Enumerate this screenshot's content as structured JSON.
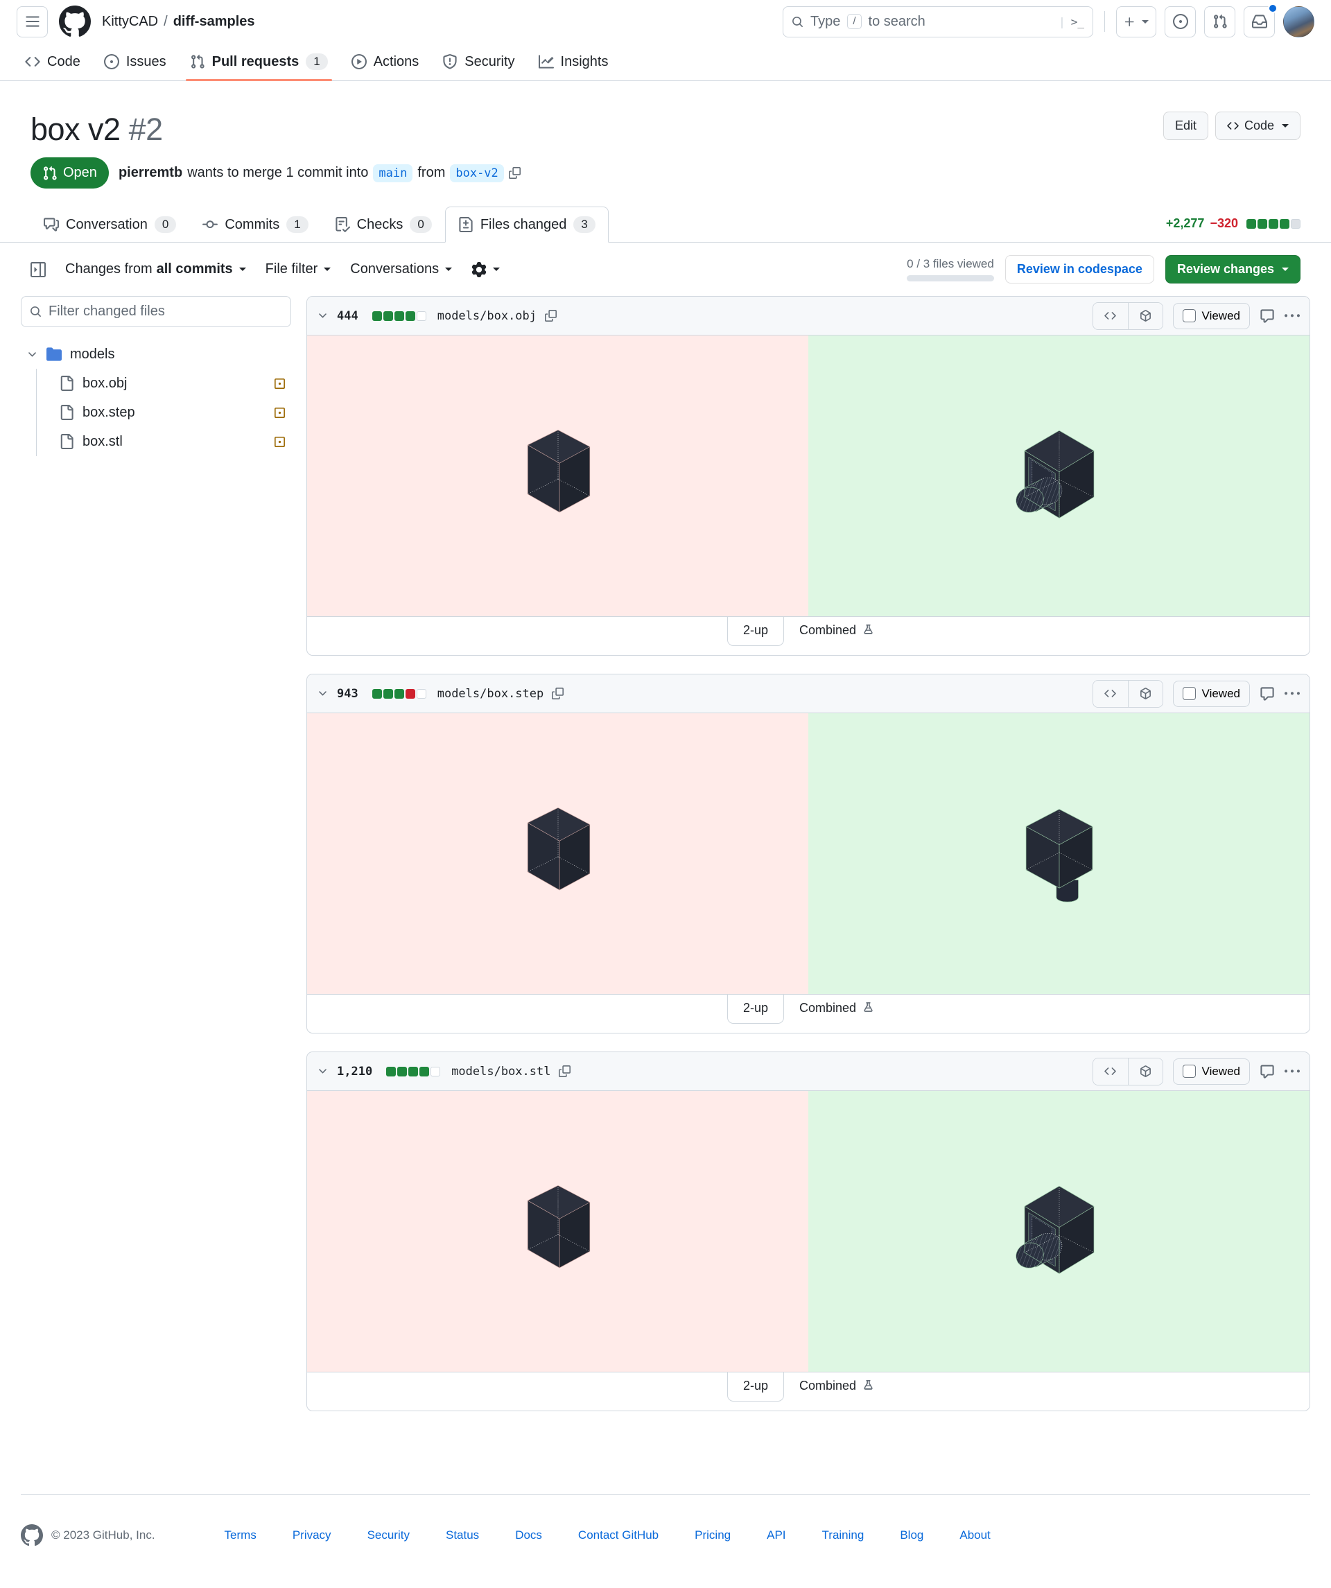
{
  "colors": {
    "accent_blue": "#0969da",
    "open_green": "#1a7f37",
    "button_green": "#1f883d",
    "deletion_red": "#cf222e",
    "nav_underline": "#fd8c73",
    "diff_red_bg": "#ffebe9",
    "diff_green_bg": "#def7e3"
  },
  "icons": {
    "hamburger": "three-lines",
    "github_logo": "octocat-mark",
    "search": "magnifier",
    "command_palette": ">_",
    "notification": "inbox-with-blue-dot",
    "file_status_modified": "square-with-dot"
  },
  "header": {
    "org": "KittyCAD",
    "separator": "/",
    "repo": "diff-samples",
    "search_placeholder": "Type",
    "slash_key": "/",
    "search_placeholder_rest": "to search",
    "command_palette_glyph": ">_",
    "plus_glyph": "+"
  },
  "repo_nav": [
    {
      "label": "Code"
    },
    {
      "label": "Issues"
    },
    {
      "label": "Pull requests",
      "count": "1"
    },
    {
      "label": "Actions"
    },
    {
      "label": "Security"
    },
    {
      "label": "Insights"
    }
  ],
  "pr_header": {
    "title": "box v2",
    "number": "#2",
    "edit_label": "Edit",
    "code_label": "Code",
    "state": "Open",
    "author": "pierremtb",
    "merge_text": "wants to merge 1 commit into",
    "base_branch": "main",
    "from_text": "from",
    "head_branch": "box-v2"
  },
  "pr_tabs": [
    {
      "label": "Conversation",
      "count": "0"
    },
    {
      "label": "Commits",
      "count": "1"
    },
    {
      "label": "Checks",
      "count": "0"
    },
    {
      "label": "Files changed",
      "count": "3"
    }
  ],
  "diffstat": {
    "additions": "+2,277",
    "deletions": "−320",
    "blocks": [
      "added",
      "added",
      "added",
      "added",
      "neutral"
    ]
  },
  "toolbar": {
    "changes_from": "Changes from",
    "changes_from_value": "all commits",
    "file_filter": "File filter",
    "conversations": "Conversations",
    "files_viewed": "0 / 3 files viewed",
    "review_in_codespace": "Review in codespace",
    "review_changes": "Review changes"
  },
  "sidebar": {
    "filter_placeholder": "Filter changed files",
    "folder": "models",
    "files": [
      "box.obj",
      "box.step",
      "box.stl"
    ]
  },
  "file_panels": [
    {
      "changes": "444",
      "path": "models/box.obj",
      "blocks": [
        "added",
        "added",
        "added",
        "added",
        "empty"
      ],
      "viewed_label": "Viewed",
      "tab_2up": "2-up",
      "tab_combined": "Combined",
      "before": "cube-plain",
      "after": "cube-hole"
    },
    {
      "changes": "943",
      "path": "models/box.step",
      "blocks": [
        "added",
        "added",
        "added",
        "deleted",
        "empty"
      ],
      "viewed_label": "Viewed",
      "tab_2up": "2-up",
      "tab_combined": "Combined",
      "before": "cube-plain",
      "after": "cube-plug"
    },
    {
      "changes": "1,210",
      "path": "models/box.stl",
      "blocks": [
        "added",
        "added",
        "added",
        "added",
        "empty"
      ],
      "viewed_label": "Viewed",
      "tab_2up": "2-up",
      "tab_combined": "Combined",
      "before": "cube-plain",
      "after": "cube-hole"
    }
  ],
  "footer": {
    "copyright": "© 2023 GitHub, Inc.",
    "links": [
      "Terms",
      "Privacy",
      "Security",
      "Status",
      "Docs",
      "Contact GitHub",
      "Pricing",
      "API",
      "Training",
      "Blog",
      "About"
    ]
  }
}
